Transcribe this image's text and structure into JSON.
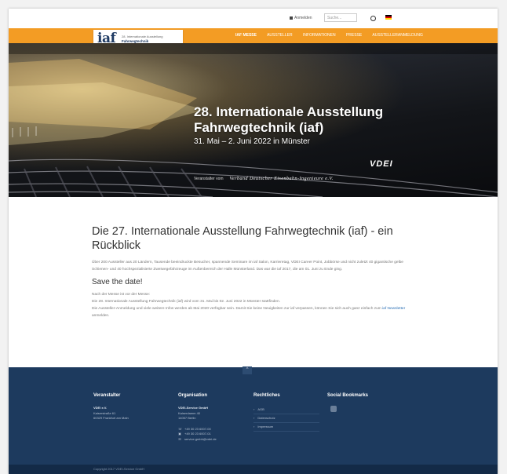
{
  "topbar": {
    "login_label": "Anmelden",
    "search_placeholder": "Suche..."
  },
  "logo": {
    "mark": "iaf",
    "line1": "28. Internationale Ausstellung",
    "line2": "Fahrwegtechnik"
  },
  "nav": {
    "items": [
      "IAF MESSE",
      "AUSSTELLER",
      "INFORMATIONEN",
      "PRESSE",
      "AUSSTELLERANMELDUNG"
    ]
  },
  "hero": {
    "title": "28. Internationale Ausstellung Fahrwegtechnik (iaf)",
    "dates": "31. Mai – 2. Juni 2022 in Münster",
    "vdei_logo": "VDEI",
    "organizer_prefix": "Veranstalter vom",
    "organizer_name": "Verband Deutscher Eisenbahn-Ingenieure e.V."
  },
  "article": {
    "title": "Die 27. Internationale Ausstellung Fahrwegtechnik (iaf) - ein Rückblick",
    "intro": "Über 200 Aussteller aus 20 Ländern, Tausende beeindruckte Besucher, spannende Seminare im iaf Salon, Karrieretag, VDEI Career Point, Jobbörse und nicht zuletzt 40 gigantische gelbe Schienen- und 40 hochspezialisierte Zweiwegefahrzeuge im Außenbereich der Halle Münsterland. Das war die iaf 2017, die am 01. Juni zu Ende ging.",
    "subheading": "Save the date!",
    "p2_line1": "Nach der Messe ist vor der Messe:",
    "p2_line2": "Die 28. Internationale Ausstellung Fahrwegtechnik (iaf) wird vom 31. Mai bis 02. Juni 2022 in Münster stattfinden.",
    "p2_line3": "Die Aussteller-Anmeldung und viele weitere Infos werden ab Mai 2020 verfügbar sein. Damit Sie keine Neuigkeiten zur iaf verpassen, können Sie sich auch ganz einfach zum",
    "newsletter_link": "iaf Newsletter",
    "p2_end": "anmelden."
  },
  "footer": {
    "scroll_top": "^",
    "col1": {
      "heading": "Veranstalter",
      "lines": [
        "VDEI e.V.",
        "Kaiserstraße 61",
        "60329 Frankfurt am Main"
      ]
    },
    "col2": {
      "heading": "Organisation",
      "lines": [
        "VDEI-Service GmbH",
        "Kaiserdamm 40",
        "14057 Berlin"
      ],
      "phone": "+49 30 23 6007-00",
      "fax": "+49 30 23 6007-01",
      "email": "service.gmbh@vdei.de"
    },
    "col3": {
      "heading": "Rechtliches",
      "links": [
        "AGB",
        "Datenschutz",
        "Impressum"
      ]
    },
    "col4": {
      "heading": "Social Bookmarks"
    },
    "copyright": "Copyright 2017 VDEI-Service GmbH"
  }
}
